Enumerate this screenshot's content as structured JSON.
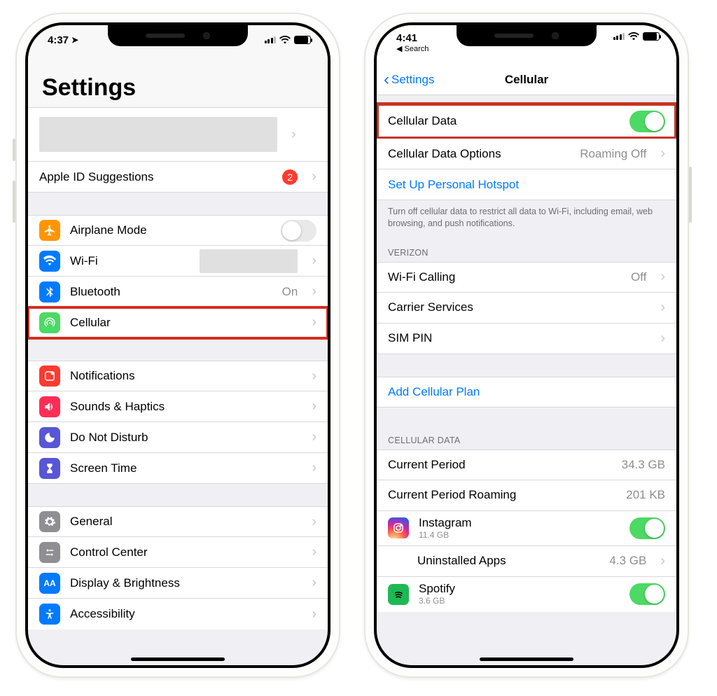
{
  "left": {
    "status": {
      "time": "4:37"
    },
    "title": "Settings",
    "appleid_row": "Apple ID Suggestions",
    "appleid_badge": "2",
    "items1": [
      {
        "label": "Airplane Mode"
      },
      {
        "label": "Wi-Fi"
      },
      {
        "label": "Bluetooth",
        "value": "On"
      },
      {
        "label": "Cellular"
      }
    ],
    "items2": [
      {
        "label": "Notifications"
      },
      {
        "label": "Sounds & Haptics"
      },
      {
        "label": "Do Not Disturb"
      },
      {
        "label": "Screen Time"
      }
    ],
    "items3": [
      {
        "label": "General"
      },
      {
        "label": "Control Center"
      },
      {
        "label": "Display & Brightness"
      },
      {
        "label": "Accessibility"
      }
    ]
  },
  "right": {
    "status": {
      "time": "4:41",
      "back": "Search"
    },
    "nav": {
      "back": "Settings",
      "title": "Cellular"
    },
    "cell_data": {
      "label": "Cellular Data"
    },
    "cell_opts": {
      "label": "Cellular Data Options",
      "value": "Roaming Off"
    },
    "hotspot": "Set Up Personal Hotspot",
    "footer1": "Turn off cellular data to restrict all data to Wi-Fi, including email, web browsing, and push notifications.",
    "carrier_header": "VERIZON",
    "carrier": [
      {
        "label": "Wi-Fi Calling",
        "value": "Off"
      },
      {
        "label": "Carrier Services"
      },
      {
        "label": "SIM PIN"
      }
    ],
    "add_plan": "Add Cellular Plan",
    "data_header": "CELLULAR DATA",
    "usage": [
      {
        "label": "Current Period",
        "value": "34.3 GB"
      },
      {
        "label": "Current Period Roaming",
        "value": "201 KB"
      }
    ],
    "apps": [
      {
        "label": "Instagram",
        "sub": "11.4 GB"
      },
      {
        "label": "Uninstalled Apps",
        "value": "4.3 GB"
      },
      {
        "label": "Spotify",
        "sub": "3.6 GB"
      }
    ]
  }
}
